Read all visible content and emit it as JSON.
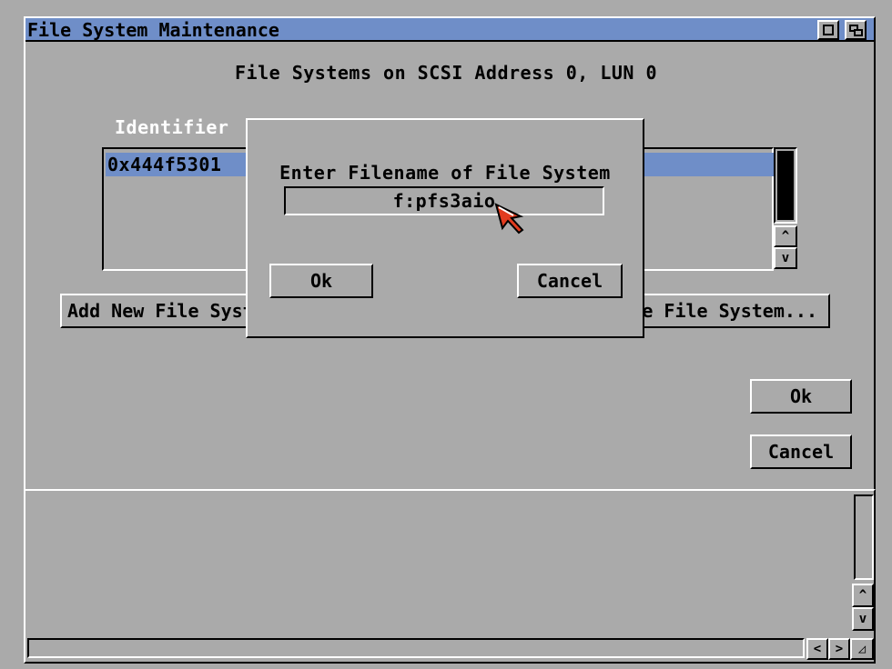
{
  "window": {
    "title": "File System Maintenance"
  },
  "main": {
    "heading": "File Systems on  SCSI  Address 0, LUN 0",
    "column_header": "Identifier",
    "list_items": [
      "0x444f5301"
    ],
    "add_button_label": "Add New File Syst",
    "update_button_label": "e File System...",
    "ok_label": "Ok",
    "cancel_label": "Cancel"
  },
  "dialog": {
    "prompt": "Enter Filename of File System",
    "input_value": "f:pfs3aio",
    "ok_label": "Ok",
    "cancel_label": "Cancel"
  },
  "icons": {
    "left_arrow": "<",
    "right_arrow": ">",
    "up_arrow": "^",
    "down_arrow": "v",
    "resize": "◿"
  },
  "colors": {
    "background": "#aaaaaa",
    "highlight": "#6f8ec8",
    "pointer": "#e23c1f"
  }
}
